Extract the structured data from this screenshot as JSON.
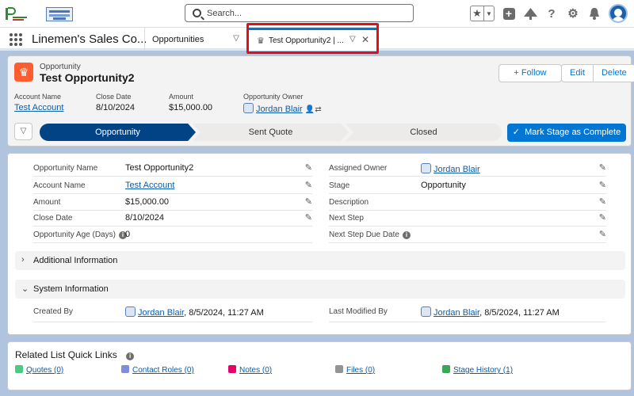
{
  "header": {
    "search_placeholder": "Search...",
    "icons": [
      "favorites-icon",
      "global-actions-icon",
      "trailhead-icon",
      "help-icon",
      "setup-icon",
      "notifications-icon",
      "user-avatar"
    ]
  },
  "nav": {
    "app_name": "Linemen's Sales Co...",
    "tabs": [
      {
        "label": "Opportunities"
      },
      {
        "label": "Test Opportunity2 | ..."
      }
    ]
  },
  "record": {
    "type_label": "Opportunity",
    "name": "Test Opportunity2",
    "buttons": {
      "follow": "Follow",
      "edit": "Edit",
      "delete": "Delete"
    },
    "highlights": [
      {
        "label": "Account Name",
        "value": "Test Account"
      },
      {
        "label": "Close Date",
        "value": "8/10/2024"
      },
      {
        "label": "Amount",
        "value": "$15,000.00"
      },
      {
        "label": "Opportunity Owner",
        "value": "Jordan Blair"
      }
    ],
    "path": {
      "stages": [
        "Opportunity",
        "Sent Quote",
        "Closed"
      ],
      "current": "Opportunity",
      "action": "Mark Stage as Complete"
    }
  },
  "details": {
    "left": [
      {
        "label": "Opportunity Name",
        "value": "Test Opportunity2"
      },
      {
        "label": "Account Name",
        "value": "Test Account"
      },
      {
        "label": "Amount",
        "value": "$15,000.00"
      },
      {
        "label": "Close Date",
        "value": "8/10/2024"
      },
      {
        "label": "Opportunity Age (Days)",
        "value": "0"
      }
    ],
    "right": [
      {
        "label": "Assigned Owner",
        "value": "Jordan Blair"
      },
      {
        "label": "Stage",
        "value": "Opportunity"
      },
      {
        "label": "Description",
        "value": ""
      },
      {
        "label": "Next Step",
        "value": ""
      },
      {
        "label": "Next Step Due Date",
        "value": ""
      }
    ],
    "sections": {
      "additional": "Additional Information",
      "system": "System Information"
    },
    "system": {
      "created_by_label": "Created By",
      "created_by_user": "Jordan Blair",
      "created_by_date": ", 8/5/2024, 11:27 AM",
      "modified_by_label": "Last Modified By",
      "modified_by_user": "Jordan Blair",
      "modified_by_date": ", 8/5/2024, 11:27 AM"
    }
  },
  "related": {
    "title": "Related List Quick Links",
    "links": [
      {
        "label": "Quotes (0)",
        "color": "#4bca81"
      },
      {
        "label": "Contact Roles (0)",
        "color": "#7f8de1"
      },
      {
        "label": "Notes (0)",
        "color": "#e3066a"
      },
      {
        "label": "Files (0)",
        "color": "#969492"
      },
      {
        "label": "Stage History (1)",
        "color": "#3ba755"
      }
    ]
  }
}
